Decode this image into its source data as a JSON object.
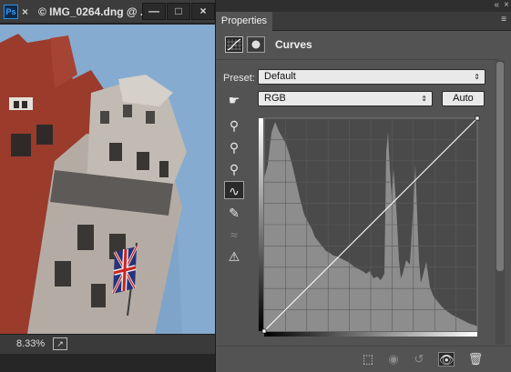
{
  "document": {
    "ps_badge": "Ps",
    "close_glyph": "×",
    "title": "© IMG_0264.dng @ ...",
    "buttons": {
      "minimize": "—",
      "restore": "□",
      "close": "×"
    },
    "zoom": "8.33%",
    "export_glyph": "↗"
  },
  "panel": {
    "collapse_glyph": "«",
    "close_glyph": "×",
    "tab_label": "Properties",
    "menu_glyph": "≡",
    "adjustment_title": "Curves",
    "preset_label": "Preset:",
    "preset_value": "Default",
    "channel_value": "RGB",
    "auto_label": "Auto",
    "dropdown_arrow": "⇕"
  },
  "tools": [
    {
      "name": "on-image-adjust-tool",
      "glyph": "☛",
      "active": false,
      "dim": false
    },
    {
      "name": "black-point-eyedropper",
      "glyph": "⚲",
      "active": false,
      "dim": false
    },
    {
      "name": "gray-point-eyedropper",
      "glyph": "⚲",
      "active": false,
      "dim": false
    },
    {
      "name": "white-point-eyedropper",
      "glyph": "⚲",
      "active": false,
      "dim": false
    },
    {
      "name": "edit-points-curve-tool",
      "glyph": "∿",
      "active": true,
      "dim": false
    },
    {
      "name": "pencil-draw-tool",
      "glyph": "✎",
      "active": false,
      "dim": false
    },
    {
      "name": "smooth-curve-tool",
      "glyph": "≈",
      "active": false,
      "dim": true
    },
    {
      "name": "clipping-warning-tool",
      "glyph": "⚠",
      "active": false,
      "dim": false
    }
  ],
  "footer": {
    "clip_glyph": "⬚",
    "view_previous_glyph": "◉",
    "reset_glyph": "↺",
    "visibility_glyph": "👁",
    "delete_glyph": "🗑"
  },
  "colors": {
    "sky": "#7fa4c9",
    "brick": "#9a3b2c",
    "stone": "#b4aca4",
    "histogram": "#8d8d8d",
    "graph_bg": "#4a4a4a"
  }
}
